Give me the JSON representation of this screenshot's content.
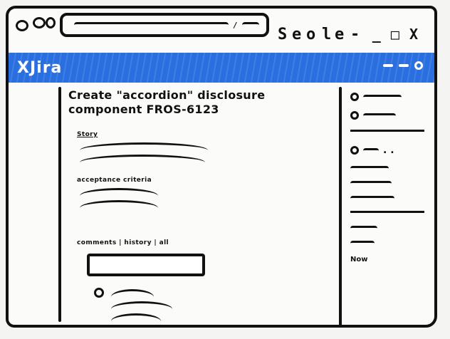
{
  "browser": {
    "url": "/",
    "window_controls": "_ □ X",
    "extension_icons": [
      "S",
      "e",
      "o",
      "l",
      "e"
    ]
  },
  "jira": {
    "logo": "XJira",
    "nav_icons": [
      "minus-icon",
      "minus-icon",
      "circle-icon"
    ]
  },
  "issue": {
    "title_line1": "Create \"accordion\" disclosure",
    "title_line2": "component  FROS-6123",
    "story_label": "Story",
    "acceptance_label": "acceptance criteria",
    "activity_label": "comments | history | all"
  },
  "sidebar": {
    "more_dots": ". .",
    "last_item": "Now"
  }
}
